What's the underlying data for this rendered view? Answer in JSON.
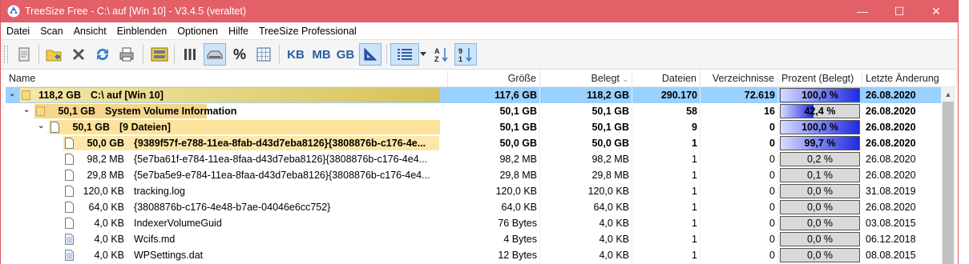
{
  "window": {
    "title": "TreeSize Free - C:\\  auf  [Win 10] - V3.4.5 (veraltet)",
    "accent_color": "#e36069",
    "controls": [
      "minimize-icon",
      "maximize-icon",
      "close-icon"
    ]
  },
  "menu": [
    "Datei",
    "Scan",
    "Ansicht",
    "Einblenden",
    "Optionen",
    "Hilfe",
    "TreeSize Professional"
  ],
  "toolbar": {
    "units": [
      "KB",
      "MB",
      "GB"
    ],
    "percent_symbol": "%",
    "icons": [
      "properties-icon",
      "folder-select-icon",
      "cancel-icon",
      "refresh-icon",
      "print-icon",
      "drives-icon",
      "columns-icon",
      "disk-size-icon",
      "percent-icon",
      "file-count-icon",
      "kb-unit",
      "mb-unit",
      "gb-unit",
      "auto-unit-icon",
      "details-view-icon",
      "sort-alpha-icon",
      "sort-size-icon"
    ]
  },
  "columns": [
    "Name",
    "Größe",
    "Belegt",
    "Dateien",
    "Verzeichnisse",
    "Prozent (Belegt)",
    "Letzte Änderung"
  ],
  "rows": [
    {
      "level": 0,
      "expand": "v",
      "icon": "folder",
      "size_label": "118,2 GB",
      "name": "C:\\  auf  [Win 10]",
      "groesse": "117,6 GB",
      "belegt": "118,2 GB",
      "dateien": "290.170",
      "verz": "72.619",
      "prozent": "100,0 %",
      "pct_value": 1.0,
      "datum": "26.08.2020",
      "bold": true,
      "selected": true,
      "bar_fraction": 1.0,
      "bar_color": "#d6c25a"
    },
    {
      "level": 1,
      "expand": "v",
      "icon": "folder",
      "size_label": "50,1 GB",
      "name": "System Volume Information",
      "groesse": "50,1 GB",
      "belegt": "50,1 GB",
      "dateien": "58",
      "verz": "16",
      "prozent": "42,4 %",
      "pct_value": 0.424,
      "datum": "26.08.2020",
      "bold": true,
      "selected": false,
      "bar_fraction": 0.424,
      "bar_color": "#f5d68c"
    },
    {
      "level": 2,
      "expand": "v",
      "icon": "file",
      "size_label": "50,1 GB",
      "name": "[9 Dateien]",
      "groesse": "50,1 GB",
      "belegt": "50,1 GB",
      "dateien": "9",
      "verz": "0",
      "prozent": "100,0 %",
      "pct_value": 1.0,
      "datum": "26.08.2020",
      "bold": true,
      "selected": false,
      "bar_fraction": 1.0,
      "bar_color": "#fde39a"
    },
    {
      "level": 3,
      "expand": "",
      "icon": "file",
      "size_label": "50,0 GB",
      "name": "{9389f57f-e788-11ea-8fab-d43d7eba8126}{3808876b-c176-4e...",
      "groesse": "50,0 GB",
      "belegt": "50,0 GB",
      "dateien": "1",
      "verz": "0",
      "prozent": "99,7 %",
      "pct_value": 0.997,
      "datum": "26.08.2020",
      "bold": true,
      "selected": false,
      "bar_fraction": 0.997,
      "bar_color": "#fde7a8"
    },
    {
      "level": 3,
      "expand": "",
      "icon": "file",
      "size_label": "98,2 MB",
      "name": "{5e7ba61f-e784-11ea-8faa-d43d7eba8126}{3808876b-c176-4e4...",
      "groesse": "98,2 MB",
      "belegt": "98,2 MB",
      "dateien": "1",
      "verz": "0",
      "prozent": "0,2 %",
      "pct_value": 0.002,
      "datum": "26.08.2020",
      "bold": false,
      "selected": false,
      "bar_fraction": 0.0,
      "bar_color": "#fde7a8"
    },
    {
      "level": 3,
      "expand": "",
      "icon": "file",
      "size_label": "29,8 MB",
      "name": "{5e7ba5e9-e784-11ea-8faa-d43d7eba8126}{3808876b-c176-4e4...",
      "groesse": "29,8 MB",
      "belegt": "29,8 MB",
      "dateien": "1",
      "verz": "0",
      "prozent": "0,1 %",
      "pct_value": 0.001,
      "datum": "26.08.2020",
      "bold": false,
      "selected": false,
      "bar_fraction": 0.0,
      "bar_color": "#fde7a8"
    },
    {
      "level": 3,
      "expand": "",
      "icon": "file",
      "size_label": "120,0 KB",
      "name": "tracking.log",
      "groesse": "120,0 KB",
      "belegt": "120,0 KB",
      "dateien": "1",
      "verz": "0",
      "prozent": "0,0 %",
      "pct_value": 0.0,
      "datum": "31.08.2019",
      "bold": false,
      "selected": false,
      "bar_fraction": 0.0,
      "bar_color": "#fde7a8"
    },
    {
      "level": 3,
      "expand": "",
      "icon": "file",
      "size_label": "64,0 KB",
      "name": "{3808876b-c176-4e48-b7ae-04046e6cc752}",
      "groesse": "64,0 KB",
      "belegt": "64,0 KB",
      "dateien": "1",
      "verz": "0",
      "prozent": "0,0 %",
      "pct_value": 0.0,
      "datum": "26.08.2020",
      "bold": false,
      "selected": false,
      "bar_fraction": 0.0,
      "bar_color": "#fde7a8"
    },
    {
      "level": 3,
      "expand": "",
      "icon": "file",
      "size_label": "4,0 KB",
      "name": "IndexerVolumeGuid",
      "groesse": "76 Bytes",
      "belegt": "4,0 KB",
      "dateien": "1",
      "verz": "0",
      "prozent": "0,0 %",
      "pct_value": 0.0,
      "datum": "03.08.2015",
      "bold": false,
      "selected": false,
      "bar_fraction": 0.0,
      "bar_color": "#fde7a8"
    },
    {
      "level": 3,
      "expand": "",
      "icon": "file-doc",
      "size_label": "4,0 KB",
      "name": "Wcifs.md",
      "groesse": "4 Bytes",
      "belegt": "4,0 KB",
      "dateien": "1",
      "verz": "0",
      "prozent": "0,0 %",
      "pct_value": 0.0,
      "datum": "06.12.2018",
      "bold": false,
      "selected": false,
      "bar_fraction": 0.0,
      "bar_color": "#fde7a8"
    },
    {
      "level": 3,
      "expand": "",
      "icon": "file-doc",
      "size_label": "4,0 KB",
      "name": "WPSettings.dat",
      "groesse": "12 Bytes",
      "belegt": "4,0 KB",
      "dateien": "1",
      "verz": "0",
      "prozent": "0,0 %",
      "pct_value": 0.0,
      "datum": "08.08.2015",
      "bold": false,
      "selected": false,
      "bar_fraction": 0.0,
      "bar_color": "#fde7a8"
    }
  ]
}
